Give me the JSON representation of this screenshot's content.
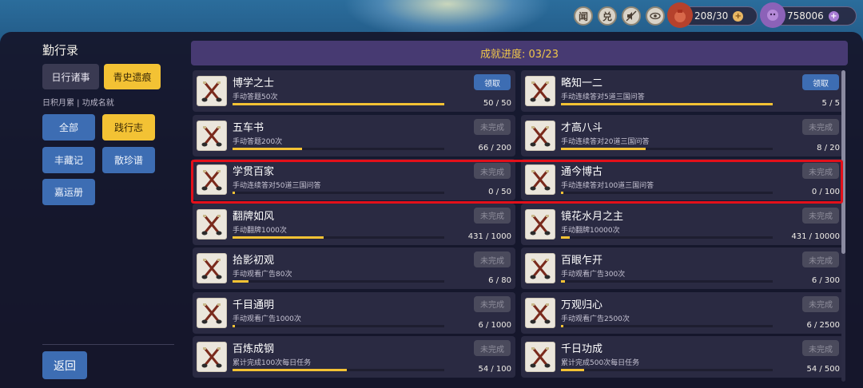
{
  "topbar": {
    "btn_wen": "闻",
    "btn_dui": "兑",
    "resource1": {
      "value": "208/30",
      "icon": "money-bag-icon",
      "coin": "coin-icon"
    },
    "resource2": {
      "value": "758006",
      "icon": "purple-creature-icon",
      "coin": "gem-icon"
    }
  },
  "sidebar": {
    "title": "勤行录",
    "tabs": [
      "日行诸事",
      "青史遗痕"
    ],
    "subtitle": "日积月累 | 功成名就",
    "categories": [
      "全部",
      "践行志",
      "丰藏记",
      "散珍谱",
      "嘉运册"
    ],
    "back": "返回"
  },
  "header": {
    "progress": "成就进度: 03/23"
  },
  "colors": {
    "accent": "#f3c234",
    "blue": "#3d6db3",
    "highlight": "#e3101a"
  },
  "cards": [
    {
      "title": "博学之士",
      "desc": "手动答题50次",
      "count": "50 / 50",
      "progress": 1.0,
      "button": "领取"
    },
    {
      "title": "略知一二",
      "desc": "手动连续答对5道三国问答",
      "count": "5 / 5",
      "progress": 1.0,
      "button": "领取"
    },
    {
      "title": "五车书",
      "desc": "手动答题200次",
      "count": "66 / 200",
      "progress": 0.33,
      "button": "未完成"
    },
    {
      "title": "才高八斗",
      "desc": "手动连续答对20道三国问答",
      "count": "8 / 20",
      "progress": 0.4,
      "button": "未完成"
    },
    {
      "title": "学贯百家",
      "desc": "手动连续答对50道三国问答",
      "count": "0 / 50",
      "progress": 0.0,
      "button": "未完成"
    },
    {
      "title": "通今博古",
      "desc": "手动连续答对100道三国问答",
      "count": "0 / 100",
      "progress": 0.0,
      "button": "未完成"
    },
    {
      "title": "翻牌如风",
      "desc": "手动翻牌1000次",
      "count": "431 / 1000",
      "progress": 0.431,
      "button": "未完成"
    },
    {
      "title": "镜花水月之主",
      "desc": "手动翻牌10000次",
      "count": "431 / 10000",
      "progress": 0.043,
      "button": "未完成"
    },
    {
      "title": "拾影初观",
      "desc": "手动观看广告80次",
      "count": "6 / 80",
      "progress": 0.075,
      "button": "未完成"
    },
    {
      "title": "百眼乍开",
      "desc": "手动观看广告300次",
      "count": "6 / 300",
      "progress": 0.02,
      "button": "未完成"
    },
    {
      "title": "千目通明",
      "desc": "手动观看广告1000次",
      "count": "6 / 1000",
      "progress": 0.006,
      "button": "未完成"
    },
    {
      "title": "万观归心",
      "desc": "手动观看广告2500次",
      "count": "6 / 2500",
      "progress": 0.0024,
      "button": "未完成"
    },
    {
      "title": "百炼成钢",
      "desc": "累计完成100次每日任务",
      "count": "54 / 100",
      "progress": 0.54,
      "button": "未完成"
    },
    {
      "title": "千日功成",
      "desc": "累计完成500次每日任务",
      "count": "54 / 500",
      "progress": 0.108,
      "button": "未完成"
    }
  ]
}
